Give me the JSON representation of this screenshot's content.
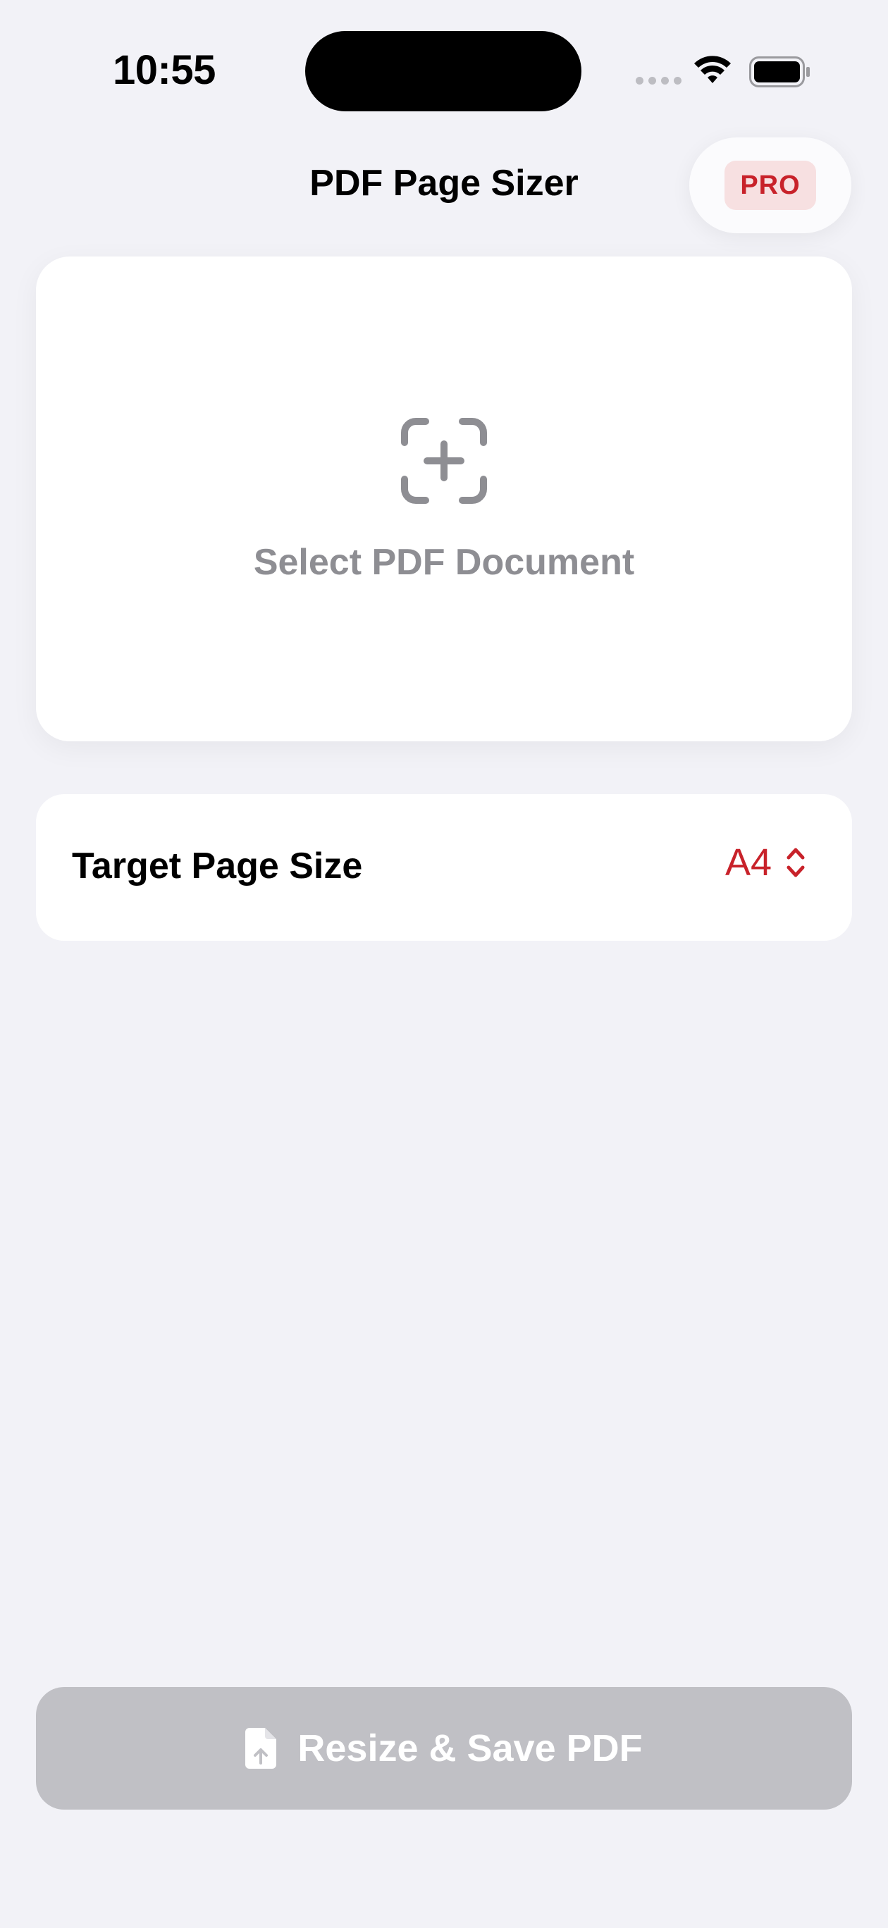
{
  "status_bar": {
    "time": "10:55"
  },
  "nav": {
    "title": "PDF Page Sizer",
    "pro_badge": "PRO"
  },
  "select_card": {
    "icon": "add-viewfinder-icon",
    "label": "Select PDF Document"
  },
  "page_size": {
    "label": "Target Page Size",
    "value": "A4",
    "icon": "chevron-up-down-icon"
  },
  "resize_button": {
    "label": "Resize & Save PDF",
    "icon": "doc-upload-icon",
    "enabled": false
  },
  "colors": {
    "accent": "#C8222A",
    "background": "#F2F2F7",
    "disabled_button": "#C0C0C5",
    "secondary_text": "#8E8E93"
  }
}
